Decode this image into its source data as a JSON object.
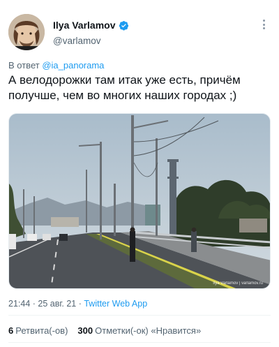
{
  "author": {
    "display_name": "Ilya Varlamov",
    "handle": "@varlamov",
    "avatar_icon": "user-avatar",
    "verified_icon": "verified-badge-icon",
    "verified_color": "#1d9bf0"
  },
  "reply": {
    "prefix": "В ответ",
    "mention": "@ia_panorama"
  },
  "tweet": {
    "text": "А велодорожки там итак уже есть, причём получше, чем во многих наших городах ;)",
    "image_watermark": "Ilya Varlamov | varlamov.ru"
  },
  "meta": {
    "time": "21:44 · 25 авг. 21 · ",
    "app": "Twitter Web App"
  },
  "stats": {
    "retweets_count": "6",
    "retweets_label": "Ретвита(-ов)",
    "likes_count": "300",
    "likes_label": "Отметки(-ок) «Нравится»"
  },
  "colors": {
    "accent": "#1d9bf0",
    "secondary_text": "#536471",
    "primary_text": "#0f1419"
  }
}
